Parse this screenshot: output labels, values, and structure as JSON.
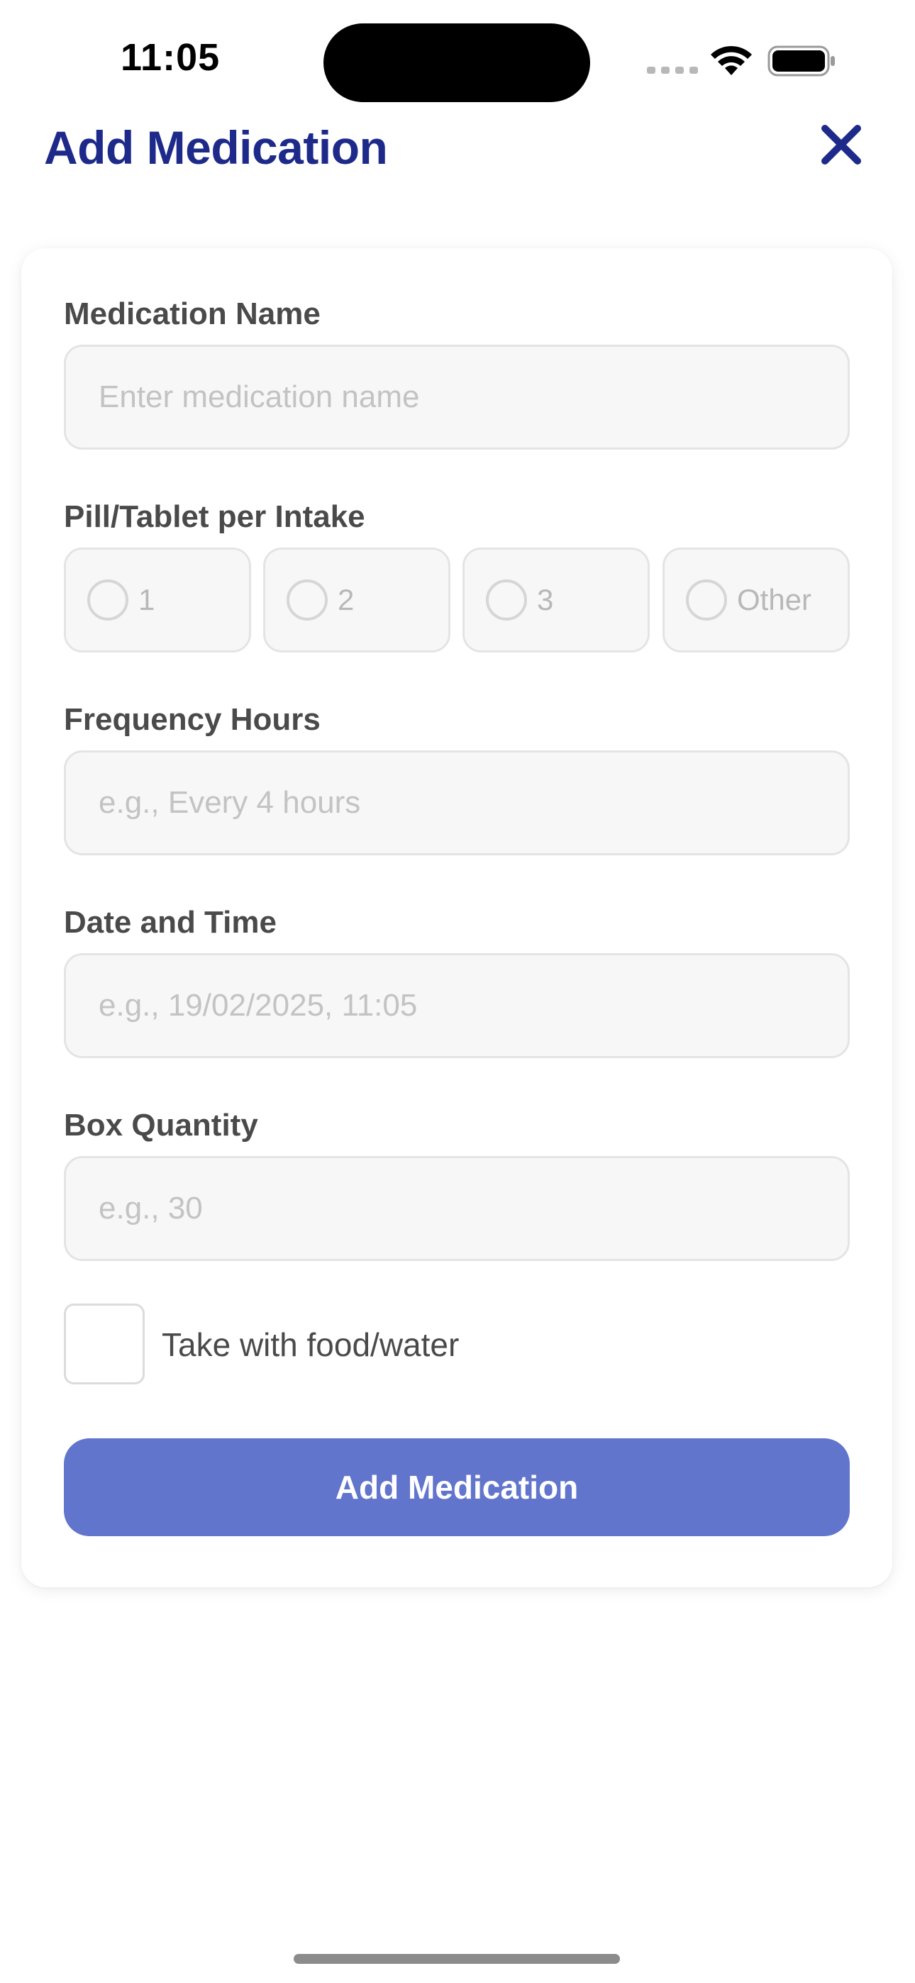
{
  "status_bar": {
    "time": "11:05"
  },
  "header": {
    "title": "Add Medication",
    "close_icon": "close-icon"
  },
  "form": {
    "medication_name": {
      "label": "Medication Name",
      "placeholder": "Enter medication name",
      "value": ""
    },
    "pills_per_intake": {
      "label": "Pill/Tablet per Intake",
      "options": [
        "1",
        "2",
        "3",
        "Other"
      ],
      "selected": null
    },
    "frequency_hours": {
      "label": "Frequency Hours",
      "placeholder": "e.g., Every 4 hours",
      "value": ""
    },
    "date_time": {
      "label": "Date and Time",
      "placeholder": "e.g., 19/02/2025, 11:05",
      "value": ""
    },
    "box_quantity": {
      "label": "Box Quantity",
      "placeholder": "e.g., 30",
      "value": ""
    },
    "take_with_food": {
      "label": "Take with food/water",
      "checked": false
    },
    "submit_label": "Add Medication"
  },
  "colors": {
    "title": "#1e2a8a",
    "primary_button": "#6275cc",
    "label_text": "#4a4a4a",
    "placeholder_text": "#c3c3c3",
    "input_background": "#f7f7f7",
    "input_border": "#e4e4e4"
  }
}
